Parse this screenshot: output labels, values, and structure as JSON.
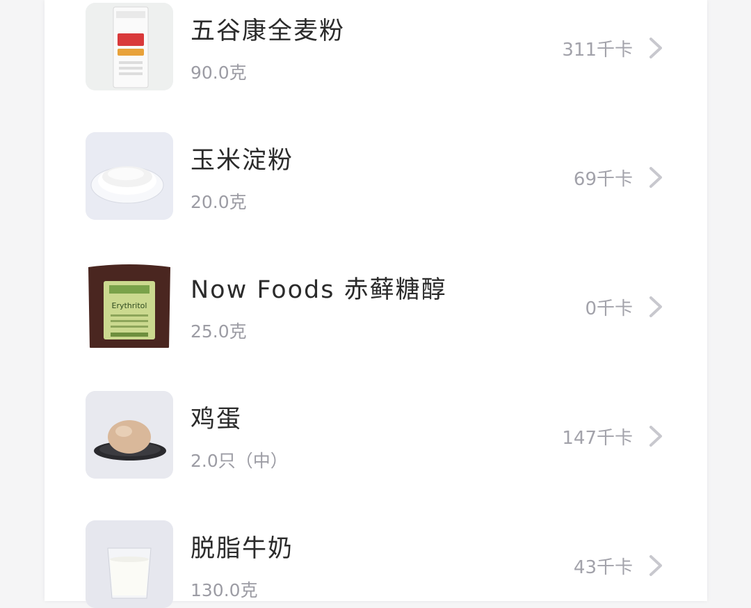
{
  "foods": [
    {
      "name": "五谷康全麦粉",
      "amount": "90.0克",
      "kcal": "311千卡",
      "image_icon": "flour-bag-icon"
    },
    {
      "name": "玉米淀粉",
      "amount": "20.0克",
      "kcal": "69千卡",
      "image_icon": "starch-plate-icon"
    },
    {
      "name": "Now Foods 赤藓糖醇",
      "amount": "25.0克",
      "kcal": "0千卡",
      "image_icon": "erythritol-bag-icon",
      "image_label": "Erythritol"
    },
    {
      "name": "鸡蛋",
      "amount": "2.0只（中）",
      "kcal": "147千卡",
      "image_icon": "egg-icon"
    },
    {
      "name": "脱脂牛奶",
      "amount": "130.0克",
      "kcal": "43千卡",
      "image_icon": "milk-glass-icon"
    }
  ],
  "colors": {
    "name_text": "#2b2b2b",
    "secondary_text": "#9c9ca4",
    "chevron": "#c8c8ce",
    "card_bg": "#ffffff",
    "page_bg": "#f5f5f6"
  }
}
